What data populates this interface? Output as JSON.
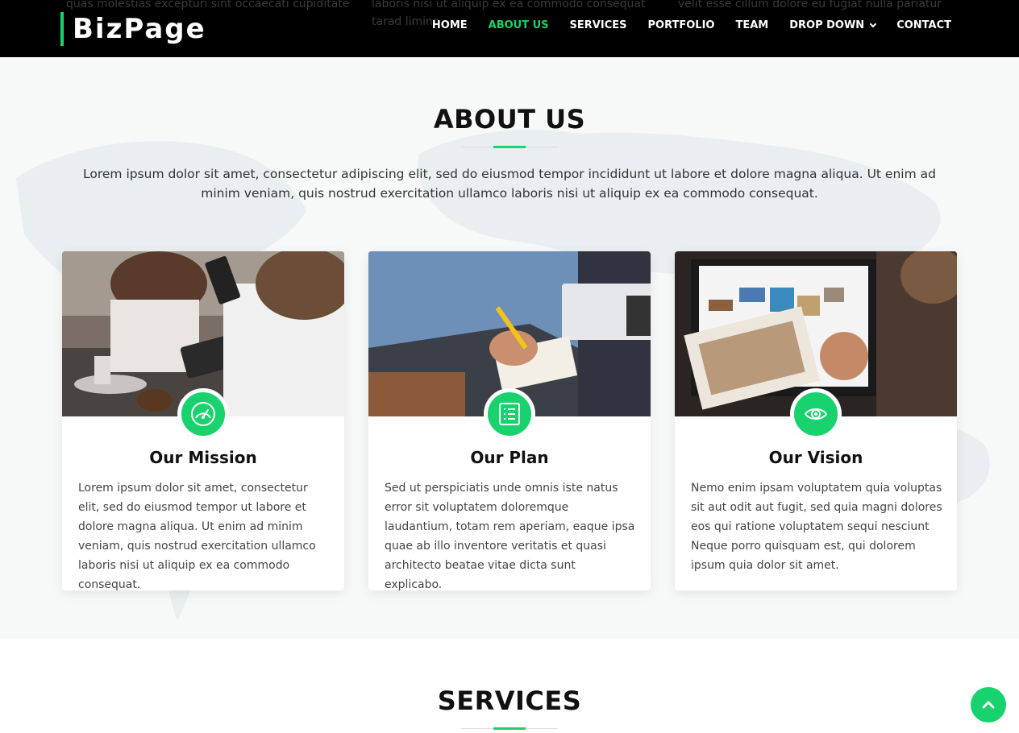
{
  "header": {
    "logo": "BizPage",
    "ghost_texts": [
      "quas molestias excepturi sint occaecati cupiditate",
      "laboris nisi ut aliquip ex ea commodo consequat",
      "tarad limino",
      "velit esse cillum dolore eu fugiat nulla pariatur"
    ],
    "nav": [
      {
        "label": "HOME"
      },
      {
        "label": "ABOUT US"
      },
      {
        "label": "SERVICES"
      },
      {
        "label": "PORTFOLIO"
      },
      {
        "label": "TEAM"
      },
      {
        "label": "DROP DOWN"
      },
      {
        "label": "CONTACT"
      }
    ],
    "active_nav": "ABOUT US"
  },
  "about": {
    "title": "ABOUT US",
    "intro": "Lorem ipsum dolor sit amet, consectetur adipiscing elit, sed do eiusmod tempor incididunt ut labore et dolore magna aliqua. Ut enim ad minim veniam, quis nostrud exercitation ullamco laboris nisi ut aliquip ex ea commodo consequat.",
    "cards": [
      {
        "title": "Our Mission",
        "icon": "speedometer-icon",
        "text": "Lorem ipsum dolor sit amet, consectetur elit, sed do eiusmod tempor ut labore et dolore magna aliqua. Ut enim ad minim veniam, quis nostrud exercitation ullamco laboris nisi ut aliquip ex ea commodo consequat."
      },
      {
        "title": "Our Plan",
        "icon": "list-icon",
        "text": "Sed ut perspiciatis unde omnis iste natus error sit voluptatem doloremque laudantium, totam rem aperiam, eaque ipsa quae ab illo inventore veritatis et quasi architecto beatae vitae dicta sunt explicabo."
      },
      {
        "title": "Our Vision",
        "icon": "eye-icon",
        "text": "Nemo enim ipsam voluptatem quia voluptas sit aut odit aut fugit, sed quia magni dolores eos qui ratione voluptatem sequi nesciunt Neque porro quisquam est, qui dolorem ipsum quia dolor sit amet."
      }
    ]
  },
  "services": {
    "title": "SERVICES"
  },
  "colors": {
    "accent": "#18d26e",
    "header_bg": "#000000",
    "about_bg": "#f7f8f8"
  }
}
